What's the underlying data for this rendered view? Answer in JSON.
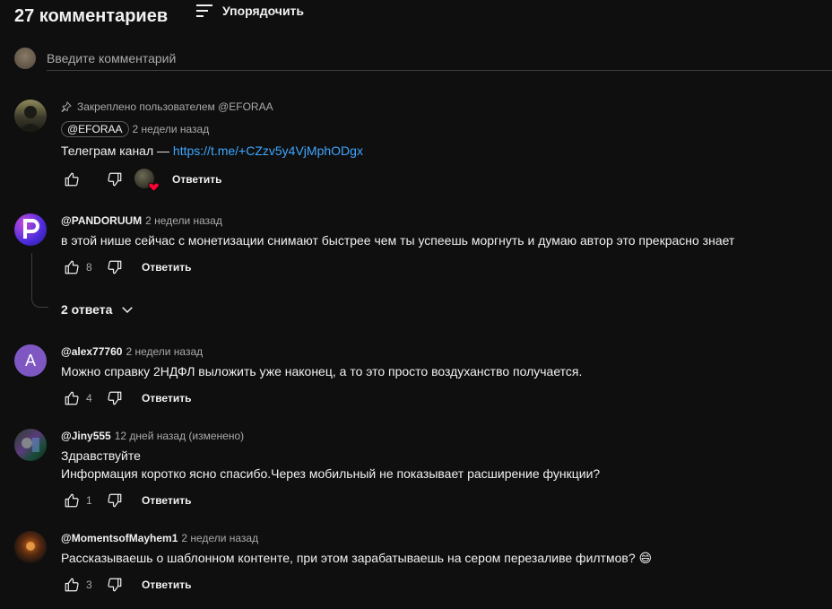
{
  "header": {
    "count": "27 комментариев",
    "sort_label": "Упорядочить"
  },
  "new_comment": {
    "placeholder": "Введите комментарий"
  },
  "comments": [
    {
      "pinned_label": "Закреплено пользователем @EFORAA",
      "author": "@EFORAA",
      "time": "2 недели назад",
      "text_prefix": "Телеграм канал — ",
      "link": "https://t.me/+CZzv5y4VjMphODgx",
      "likes": "",
      "reply": "Ответить"
    },
    {
      "author": "@PANDORUUM",
      "time": "2 недели назад",
      "text": "в этой нише сейчас с монетизации снимают быстрее чем ты успеешь моргнуть и думаю автор это прекрасно знает",
      "likes": "8",
      "reply": "Ответить",
      "replies": "2 ответа"
    },
    {
      "author": "@alex77760",
      "time": "2 недели назад",
      "avatar_letter": "A",
      "text": "Можно справку 2НДФЛ выложить уже наконец, а то это просто воздуханство получается.",
      "likes": "4",
      "reply": "Ответить"
    },
    {
      "author": "@Jiny555",
      "time": "12 дней назад (изменено)",
      "text_line1": "Здравствуйте",
      "text_line2": "Информация коротко ясно спасибо.Через мобильный не показывает расширение функции?",
      "likes": "1",
      "reply": "Ответить"
    },
    {
      "author": "@MomentsofMayhem1",
      "time": "2 недели назад",
      "text": "Рассказываешь о шаблонном контенте, при этом зарабатываешь на сером перезаливе филтмов? 😄",
      "likes": "3",
      "reply": "Ответить"
    }
  ],
  "colors": {
    "background": "#0f0f0f",
    "text": "#f1f1f1",
    "muted": "#aaaaaa",
    "link": "#3ea6ff",
    "heart": "#ff0033",
    "alex_avatar": "#7e57c2"
  }
}
